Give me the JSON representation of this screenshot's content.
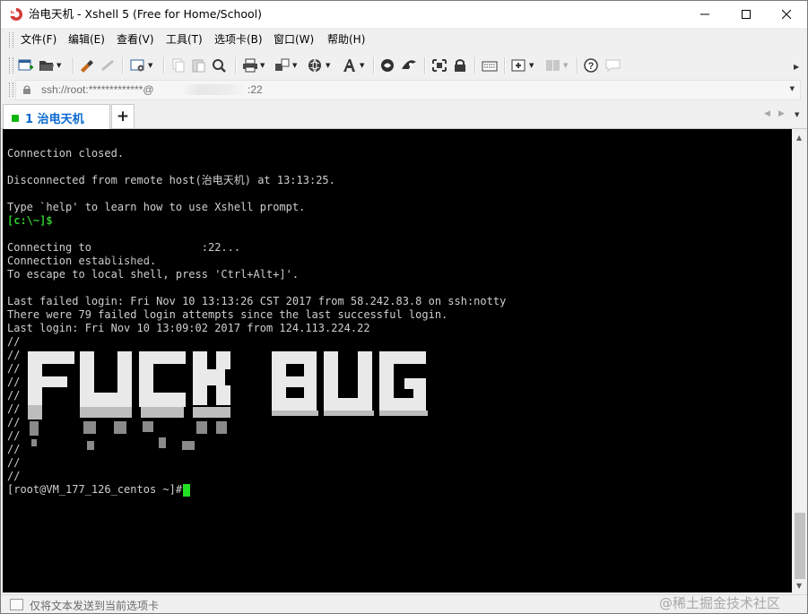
{
  "window": {
    "title": "治电天机 - Xshell 5 (Free for Home/School)"
  },
  "menu": [
    "文件(F)",
    "编辑(E)",
    "查看(V)",
    "工具(T)",
    "选项卡(B)",
    "窗口(W)",
    "帮助(H)"
  ],
  "address": {
    "value": "ssh://root:*************@",
    "port": ":22"
  },
  "tabs": {
    "active_label": "1 治电天机",
    "add_label": "+"
  },
  "terminal": {
    "lines": [
      "Connection closed.",
      "",
      "Disconnected from remote host(治电天机) at 13:13:25.",
      "",
      "Type `help' to learn how to use Xshell prompt.",
      "[c:\\~]$",
      "",
      "Connecting to                 :22...",
      "Connection established.",
      "To escape to local shell, press 'Ctrl+Alt+]'.",
      "",
      "Last failed login: Fri Nov 10 13:13:26 CST 2017 from 58.242.83.8 on ssh:notty",
      "There were 79 failed login attempts since the last successful login.",
      "Last login: Fri Nov 10 13:09:02 2017 from 124.113.224.22",
      "//",
      "//",
      "//",
      "//",
      "//",
      "//",
      "//",
      "//",
      "//",
      "//",
      "//",
      "[root@VM_177_126_centos ~]# "
    ],
    "prompt_line": "[c:\\~]$",
    "ascii_art_text": "FUCK BUG",
    "prompt_color": "#30c630",
    "cursor_color": "#22e022"
  },
  "status": {
    "text": "仅将文本发送到当前选项卡",
    "watermark": "@稀土掘金技术社区"
  },
  "icons": [
    "app-icon",
    "minimize-icon",
    "maximize-icon",
    "close-icon",
    "new-session-icon",
    "open-folder-icon",
    "reconnect-icon",
    "disconnect-icon",
    "properties-icon",
    "copy-icon",
    "paste-icon",
    "find-icon",
    "print-icon",
    "transfer-icon",
    "globe-icon",
    "font-icon",
    "xftp-icon",
    "xmanager-icon",
    "fullscreen-icon",
    "lock-icon",
    "keyboard-icon",
    "new-tab-icon",
    "layout-icon",
    "help-icon",
    "comment-icon",
    "lock-small-icon",
    "dropdown-icon",
    "scroll-up-icon",
    "scroll-down-icon",
    "send-text-icon"
  ]
}
